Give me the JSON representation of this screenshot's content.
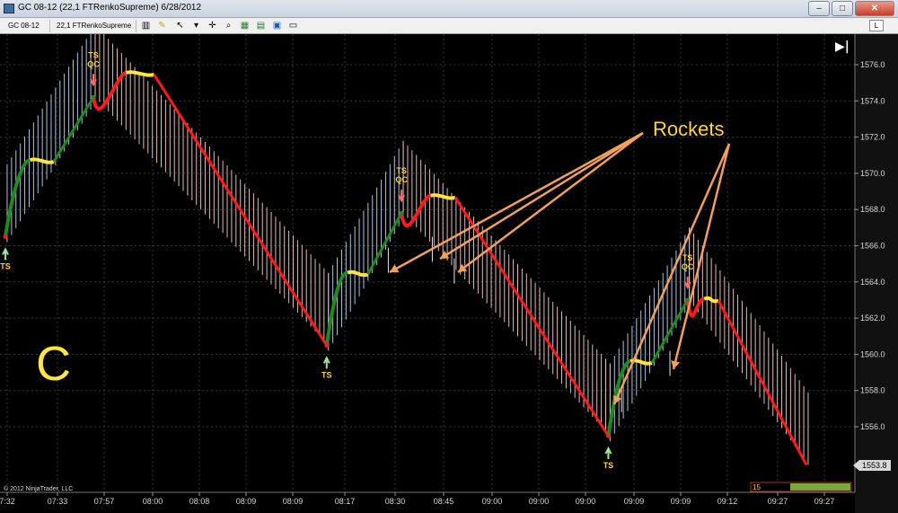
{
  "window": {
    "title": "GC 08-12 (22,1 FTRenkoSupreme)  6/28/2012",
    "minimize_glyph": "–",
    "maximize_glyph": "□",
    "close_glyph": "✕"
  },
  "toolbar": {
    "instrument": "GC 08-12",
    "bar_type": "22,1 FTRenkoSupreme",
    "badge": "L",
    "icons": [
      "bar-style-icon",
      "pencil-icon",
      "pointer-icon",
      "crosshair-icon",
      "zoom-icon",
      "indicators-icon",
      "strategies-icon",
      "properties-icon",
      "data-box-icon"
    ]
  },
  "chart": {
    "copyright": "© 2012 NinjaTrader, LLC",
    "big_label": "C",
    "rockets_label": "Rockets",
    "current_price": "1553.8",
    "counter": "15",
    "scroll_end_glyph": "▶|",
    "price_ticks": [
      "1576.0",
      "1574.0",
      "1572.0",
      "1570.0",
      "1568.0",
      "1566.0",
      "1564.0",
      "1562.0",
      "1560.0",
      "1558.0",
      "1556.0"
    ],
    "time_ticks": [
      "7:32",
      "07:33",
      "07:57",
      "08:00",
      "08:08",
      "08:09",
      "08:09",
      "08:17",
      "08:30",
      "08:45",
      "09:00",
      "09:00",
      "09:00",
      "09:09",
      "09:09",
      "09:12",
      "09:27",
      "09:27"
    ],
    "colors": {
      "up_bar": "#a9c3e6",
      "down_bar": "#e7b8b8",
      "red": "#ff1a1a",
      "green": "#1f8a1f",
      "yellow": "#ffe53d",
      "annotation": "#ffd23a",
      "arrow": "#f2a05a"
    }
  },
  "chart_data": {
    "type": "bar",
    "ylim": [
      1553.0,
      1577.0
    ],
    "y_ticks": [
      1576,
      1574,
      1572,
      1570,
      1568,
      1566,
      1564,
      1562,
      1560,
      1558,
      1556
    ],
    "segments": [
      {
        "dir": "up",
        "start_bar": 0,
        "end_bar": 20,
        "from": 1566.5,
        "to": 1574.2
      },
      {
        "dir": "down",
        "start_bar": 20,
        "end_bar": 73,
        "from": 1574.2,
        "to": 1560.5
      },
      {
        "dir": "up",
        "start_bar": 73,
        "end_bar": 90,
        "from": 1560.5,
        "to": 1567.8
      },
      {
        "dir": "down",
        "start_bar": 90,
        "end_bar": 137,
        "from": 1567.8,
        "to": 1555.5
      },
      {
        "dir": "up",
        "start_bar": 137,
        "end_bar": 155,
        "from": 1555.5,
        "to": 1563.0
      },
      {
        "dir": "down",
        "start_bar": 155,
        "end_bar": 182,
        "from": 1563.0,
        "to": 1553.9
      }
    ],
    "signals": [
      {
        "bar": 0,
        "price": 1566.5,
        "kind": "buy",
        "labels": [
          "TS"
        ]
      },
      {
        "bar": 20,
        "price": 1574.2,
        "kind": "sell",
        "labels": [
          "TS",
          "QC"
        ]
      },
      {
        "bar": 73,
        "price": 1560.5,
        "kind": "buy",
        "labels": [
          "TS"
        ]
      },
      {
        "bar": 90,
        "price": 1567.8,
        "kind": "sell",
        "labels": [
          "TS",
          "QC"
        ]
      },
      {
        "bar": 137,
        "price": 1555.5,
        "kind": "buy",
        "labels": [
          "TS"
        ]
      },
      {
        "bar": 155,
        "price": 1563.0,
        "kind": "sell",
        "labels": [
          "TS",
          "QC"
        ]
      }
    ],
    "rockets": [
      {
        "bar": 87,
        "price": 1565.2
      },
      {
        "bar": 97,
        "price": 1565.8
      },
      {
        "bar": 102,
        "price": 1564.6
      },
      {
        "bar": 140,
        "price": 1557.5
      },
      {
        "bar": 151,
        "price": 1559.5
      }
    ]
  }
}
